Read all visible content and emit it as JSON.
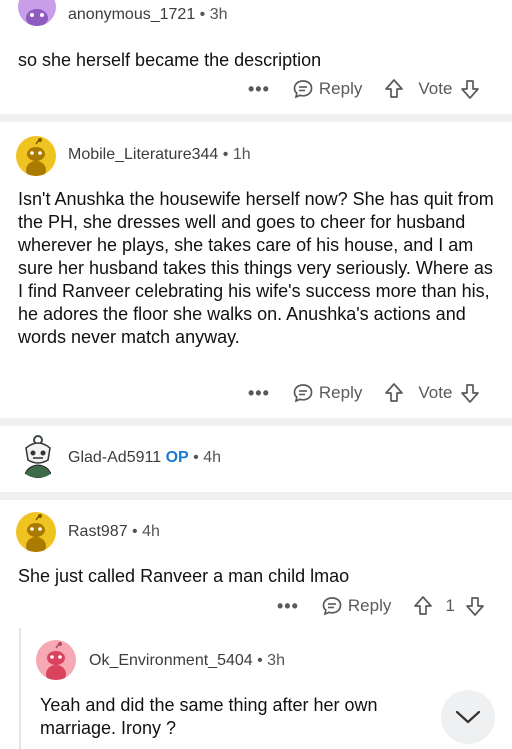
{
  "comments": [
    {
      "username": "anonymous_1721",
      "time": "3h",
      "body": "so she herself became the description",
      "reply_label": "Reply",
      "vote_label": "Vote"
    },
    {
      "username": "Mobile_Literature344",
      "time": "1h",
      "body": "Isn't Anushka the housewife herself now? She has quit from the PH, she dresses well and goes to cheer for husband wherever he plays, she takes care of his house, and I am sure her husband takes this things very seriously. Where as I find Ranveer celebrating his wife's success more than his, he adores the floor she walks on. Anushka's actions and words never match anyway.",
      "reply_label": "Reply",
      "vote_label": "Vote"
    },
    {
      "username": "Glad-Ad5911",
      "op_badge": "OP",
      "time": "4h"
    },
    {
      "username": "Rast987",
      "time": "4h",
      "body": "She just called Ranveer a man child lmao",
      "reply_label": "Reply",
      "vote_count": "1"
    },
    {
      "username": "Ok_Environment_5404",
      "time": "3h",
      "body": "Yeah and did the same thing after her own marriage. Irony ?"
    }
  ],
  "separator_dot": "•",
  "more_glyph": "•••",
  "colors": {
    "avatar_yellow": "#f0c420",
    "avatar_purple": "#c89ee8",
    "avatar_pink": "#f6a8b4",
    "op_blue": "#1a7ad1",
    "separator": "#eef0f1"
  }
}
